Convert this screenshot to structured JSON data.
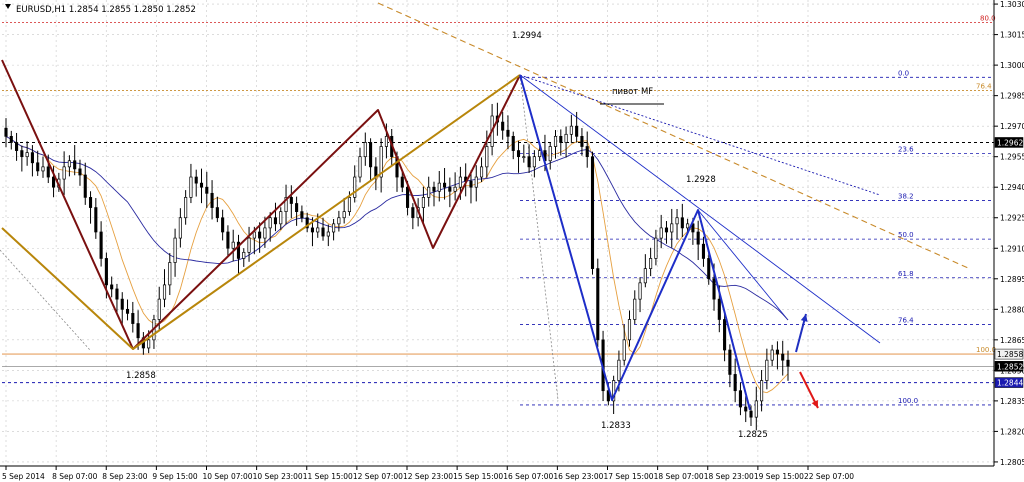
{
  "header": {
    "symbol_info": "EURUSD,H1  1.2854 1.2855 1.2850 1.2852"
  },
  "colors": {
    "background": "#ffffff",
    "candles": "#000000",
    "grid": "#c8c8c8",
    "price_axis": "#000000",
    "fib_blue": "#1a1ab0",
    "fib_orange": "#c88a2a",
    "zigzag_darkred": "#7a1010",
    "zigzag_gold": "#b8860b",
    "wave_blue": "#1e2ec8",
    "ma_blue": "#2b2ba0",
    "ma_orange": "#e6a040",
    "level_red": "#d02020",
    "arrow_up": "#2030c0",
    "arrow_down": "#e01818",
    "current_price_tag": "#000000"
  },
  "chart_data": {
    "type": "candlestick",
    "symbol": "EURUSD",
    "timeframe": "H1",
    "ylim": [
      1.2803,
      1.3032
    ],
    "price_ticks": [
      "1.3030",
      "1.3015",
      "1.3000",
      "1.2985",
      "1.2970",
      "1.2955",
      "1.2940",
      "1.2925",
      "1.2910",
      "1.2895",
      "1.2880",
      "1.2865",
      "1.2850",
      "1.2835",
      "1.2820",
      "1.2805"
    ],
    "time_labels": [
      "5 Sep 2014",
      "8 Sep 07:00",
      "8 Sep 23:00",
      "9 Sep 15:00",
      "10 Sep 07:00",
      "10 Sep 23:00",
      "11 Sep 15:00",
      "12 Sep 07:00",
      "12 Sep 23:00",
      "15 Sep 15:00",
      "16 Sep 07:00",
      "16 Sep 23:00",
      "17 Sep 15:00",
      "18 Sep 07:00",
      "18 Sep 23:00",
      "19 Sep 15:00",
      "22 Sep 07:00"
    ],
    "closes": [
      1.2965,
      1.2962,
      1.2958,
      1.2955,
      1.2957,
      1.2952,
      1.2948,
      1.295,
      1.2945,
      1.294,
      1.2944,
      1.295,
      1.2953,
      1.2949,
      1.2946,
      1.2935,
      1.293,
      1.2918,
      1.2905,
      1.2892,
      1.289,
      1.2885,
      1.288,
      1.2878,
      1.2873,
      1.2866,
      1.2861,
      1.2865,
      1.2875,
      1.2885,
      1.2892,
      1.2903,
      1.2915,
      1.2925,
      1.2935,
      1.2945,
      1.2942,
      1.294,
      1.2937,
      1.293,
      1.2925,
      1.2918,
      1.291,
      1.2913,
      1.2905,
      1.2908,
      1.2915,
      1.2918,
      1.2915,
      1.292,
      1.2925,
      1.2922,
      1.2928,
      1.2935,
      1.2932,
      1.2928,
      1.2925,
      1.292,
      1.2918,
      1.292,
      1.2916,
      1.2918,
      1.2922,
      1.2925,
      1.2928,
      1.2935,
      1.2945,
      1.2955,
      1.2962,
      1.295,
      1.2945,
      1.296,
      1.2965,
      1.2955,
      1.2945,
      1.294,
      1.293,
      1.2925,
      1.293,
      1.2935,
      1.294,
      1.2938,
      1.2942,
      1.294,
      1.2938,
      1.294,
      1.2945,
      1.2943,
      1.294,
      1.2945,
      1.295,
      1.296,
      1.2975,
      1.2972,
      1.2968,
      1.2965,
      1.2958,
      1.2955,
      1.2955,
      1.295,
      1.2955,
      1.2958,
      1.2953,
      1.296,
      1.2965,
      1.2962,
      1.2966,
      1.297,
      1.2965,
      1.296,
      1.2955,
      1.29,
      1.2865,
      1.284,
      1.2835,
      1.2845,
      1.2855,
      1.2865,
      1.2875,
      1.2885,
      1.2893,
      1.29,
      1.2905,
      1.2915,
      1.292,
      1.2918,
      1.2922,
      1.2925,
      1.292,
      1.2922,
      1.2918,
      1.2912,
      1.2905,
      1.2895,
      1.2885,
      1.2875,
      1.286,
      1.2848,
      1.284,
      1.2832,
      1.283,
      1.2827,
      1.2835,
      1.2845,
      1.2855,
      1.286,
      1.2858,
      1.2855,
      1.2852
    ],
    "price_labels": [
      {
        "text": "1.2994",
        "price": 1.2994
      },
      {
        "text": "1.2858",
        "price": 1.2858
      },
      {
        "text": "1.2928",
        "price": 1.2928
      },
      {
        "text": "1.2833",
        "price": 1.2833
      },
      {
        "text": "1.2825",
        "price": 1.2825
      }
    ],
    "annotation_text": "пивот MF",
    "fib_levels_blue": [
      {
        "label": "0.0",
        "price": 1.2994
      },
      {
        "label": "23.6",
        "price": 1.29565
      },
      {
        "label": "38.2",
        "price": 1.29335
      },
      {
        "label": "50.0",
        "price": 1.29145
      },
      {
        "label": "61.8",
        "price": 1.28955
      },
      {
        "label": "76.4",
        "price": 1.28725
      },
      {
        "label": "100.0",
        "price": 1.2833
      }
    ],
    "fib_levels_orange": [
      {
        "label": "80.0",
        "price": 1.3021
      },
      {
        "label": "76.4",
        "price": 1.29875
      },
      {
        "label": "100.0",
        "price": 1.2858
      }
    ],
    "horizontal_levels": [
      {
        "price": 1.2962,
        "tag": "1.2962",
        "style": "dashed-black"
      },
      {
        "price": 1.2844,
        "tag": "1.2844",
        "style": "dashed-blue"
      },
      {
        "price": 1.2852,
        "tag": "1.2852",
        "style": "current"
      },
      {
        "price": 1.2858,
        "tag": "1.2858",
        "style": "orange"
      }
    ]
  }
}
